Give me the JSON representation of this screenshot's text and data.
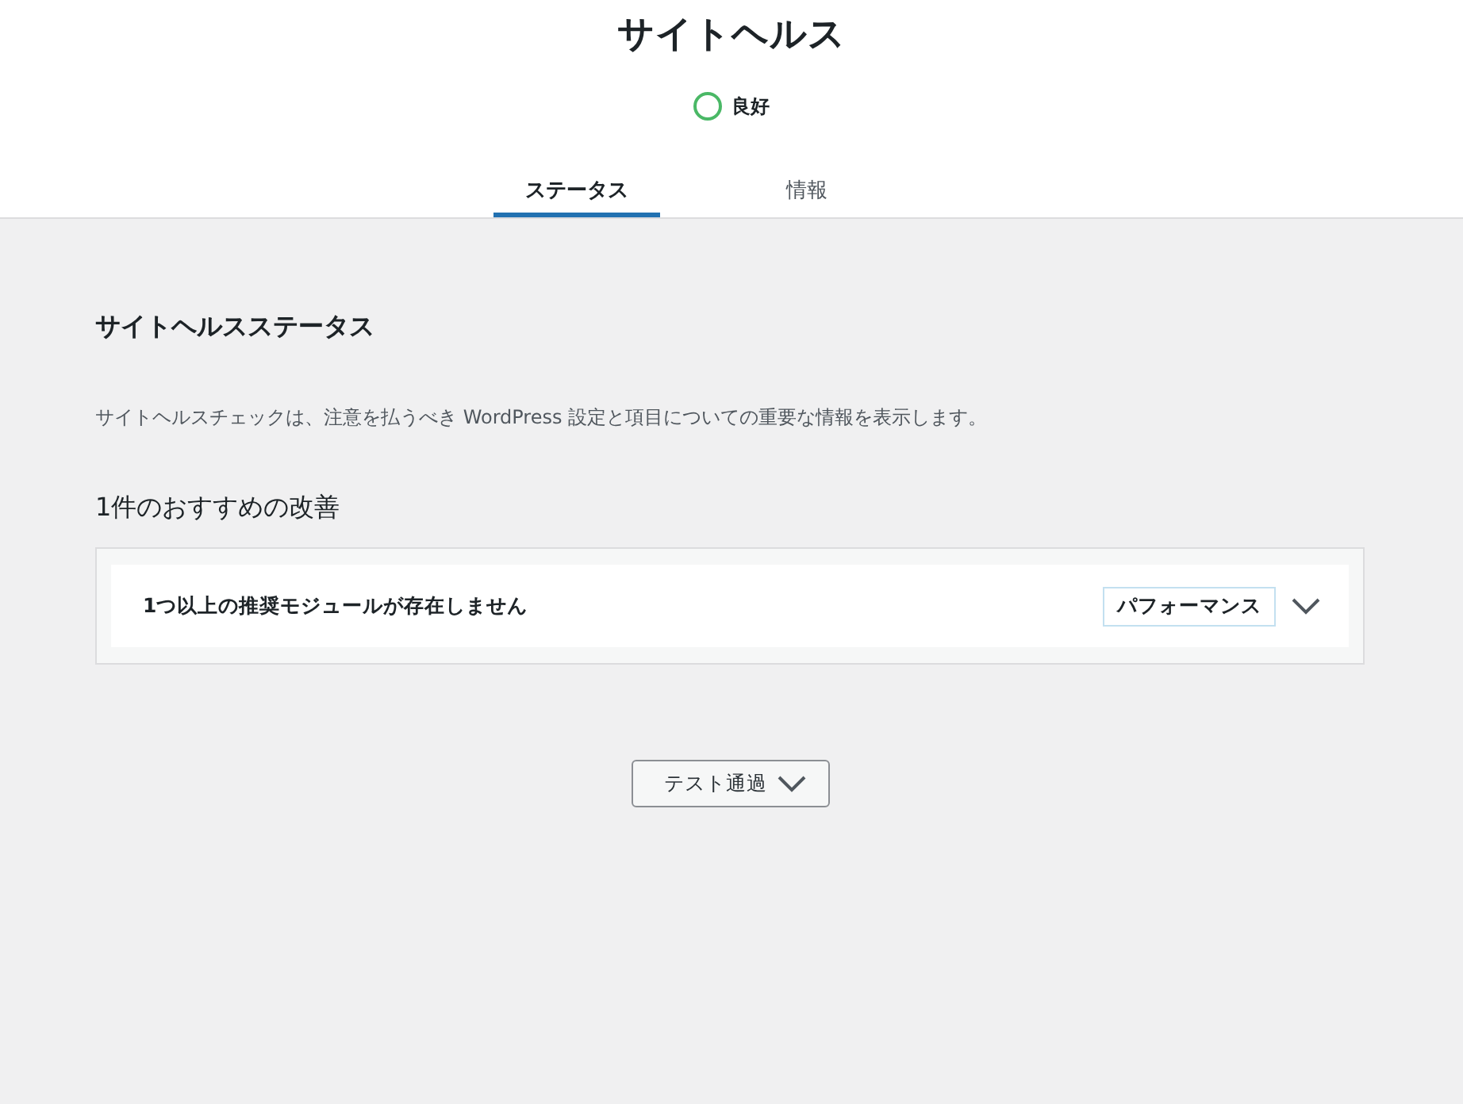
{
  "header": {
    "title": "サイトヘルス",
    "status": {
      "kind": "good",
      "label": "良好"
    }
  },
  "tabs": [
    {
      "label": "ステータス",
      "selected": true
    },
    {
      "label": "情報",
      "selected": false
    }
  ],
  "section": {
    "title": "サイトヘルスステータス",
    "description": "サイトヘルスチェックは、注意を払うべき WordPress 設定と項目についての重要な情報を表示します。",
    "issues_heading": "1件のおすすめの改善",
    "issues": [
      {
        "title": "1つ以上の推奨モジュールが存在しません",
        "badge": "パフォーマンス",
        "color": "#c3e0f0",
        "expanded": false
      }
    ]
  },
  "passed_button": {
    "label": "テスト通過",
    "expanded": false
  }
}
